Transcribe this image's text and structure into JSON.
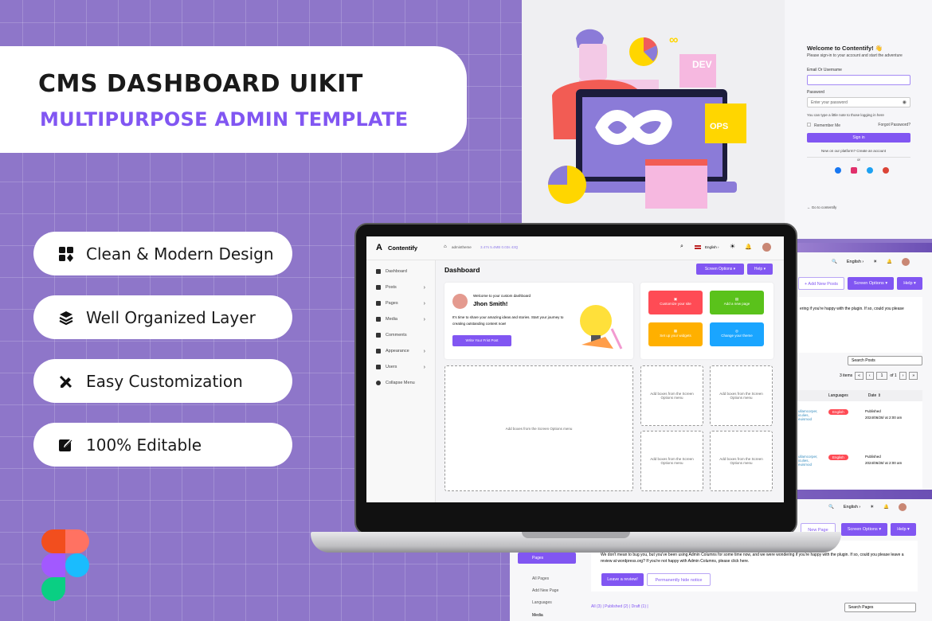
{
  "hero": {
    "title": "CMS DASHBOARD UIKIT",
    "subtitle": "MULTIPURPOSE ADMIN TEMPLATE"
  },
  "features": [
    {
      "icon": "grid-shapes-icon",
      "label": "Clean & Modern Design"
    },
    {
      "icon": "layers-icon",
      "label": "Well Organized Layer"
    },
    {
      "icon": "pencil-ruler-icon",
      "label": "Easy Customization"
    },
    {
      "icon": "edit-square-icon",
      "label": "100% Editable"
    }
  ],
  "colors": {
    "accent": "#8156f2",
    "background": "#8e76c9",
    "red": "#ff4b55",
    "green": "#5ac21b",
    "orange": "#ffb000",
    "blue": "#1aa5ff"
  },
  "illustration": {
    "dev_label": "DEV",
    "ops_label": "OPS"
  },
  "login": {
    "welcome": "Welcome to Contentify! 👋",
    "subtitle": "Please sign-in to your account and start the adventure",
    "email_label": "Email Or Username",
    "email_value": "",
    "password_label": "Password",
    "password_placeholder": "Enter your password",
    "note": "You can type a little note to those logging in here",
    "remember": "Remember Me",
    "forgot": "Forgot Password?",
    "signin": "Sign in",
    "new_account": "New on our platform? Create an account",
    "or": "or",
    "go_back": "← Go to contentify"
  },
  "app": {
    "brand": "Contentify",
    "site": "admintheme",
    "stats": "3.47s  5.4MB  0.03s  43Q",
    "language": "English",
    "page_title": "Dashboard",
    "screen_options": "Screen Options ▾",
    "help": "Help ▾",
    "sidebar": [
      {
        "label": "Dashboard",
        "chevron": false
      },
      {
        "label": "Posts",
        "chevron": true
      },
      {
        "label": "Pages",
        "chevron": true
      },
      {
        "label": "Media",
        "chevron": true
      },
      {
        "label": "Comments",
        "chevron": false
      },
      {
        "label": "Appearance",
        "chevron": true
      },
      {
        "label": "Users",
        "chevron": true
      },
      {
        "label": "Collapse Menu",
        "chevron": false
      }
    ],
    "welcome": {
      "heading": "Welcome to your custom dashboard",
      "name": "Jhon Smith!",
      "text": "It's time to share your amazing ideas and stories. Start your journey to creating outstanding content now!",
      "button": "Write Your Frist Post"
    },
    "tiles": [
      {
        "label": "Customize your site",
        "color": "#ff4b55"
      },
      {
        "label": "Add a new page",
        "color": "#5ac21b"
      },
      {
        "label": "Set up your widgets",
        "color": "#ffb000"
      },
      {
        "label": "Change your theme",
        "color": "#1aa5ff"
      }
    ],
    "placeholder": "Add boxes from the Screen Options menu"
  },
  "posts_screen": {
    "language": "English",
    "add_new": "+ Add New Posts",
    "screen_options": "Screen Options ▾",
    "help": "Help ▾",
    "notice": "ering if you're happy with the  plugin. If so, could you please",
    "search_placeholder": "Search Posts",
    "items": "3 items",
    "page": "1",
    "of": "of 1",
    "columns": [
      "Languages",
      "Date ⇕"
    ],
    "rows": [
      {
        "lang": "English",
        "status": "Published",
        "date": "2024/06/28/ at 2:00 am",
        "tags": "ullamcorper, iculies, euismod"
      },
      {
        "lang": "English",
        "status": "Published",
        "date": "2024/06/28/ at 2:00 am",
        "tags": "ullamcorper, iculies, euismod"
      }
    ]
  },
  "pages_screen": {
    "language": "English",
    "add_new": "New Page",
    "screen_options": "Screen Options ▾",
    "help": "Help ▾",
    "sidebar_active": "Pages",
    "sub_items": [
      "All Pages",
      "Add New Page",
      "Languages"
    ],
    "media": "Media",
    "notice": "We don't mean to bug you, but you've been using Admin Columns for some time now, and we were wondering if you're happy with the  plugin. If so, could you please leave a review at wordpress.org? If  you're not happy with Admin Columns, please click here.",
    "leave_review": "Leave a review!",
    "hide_notice": "Permanently hide notice",
    "filters": "All (3) | Published (2) | Draft (1) |",
    "search_placeholder": "Search Pages"
  }
}
